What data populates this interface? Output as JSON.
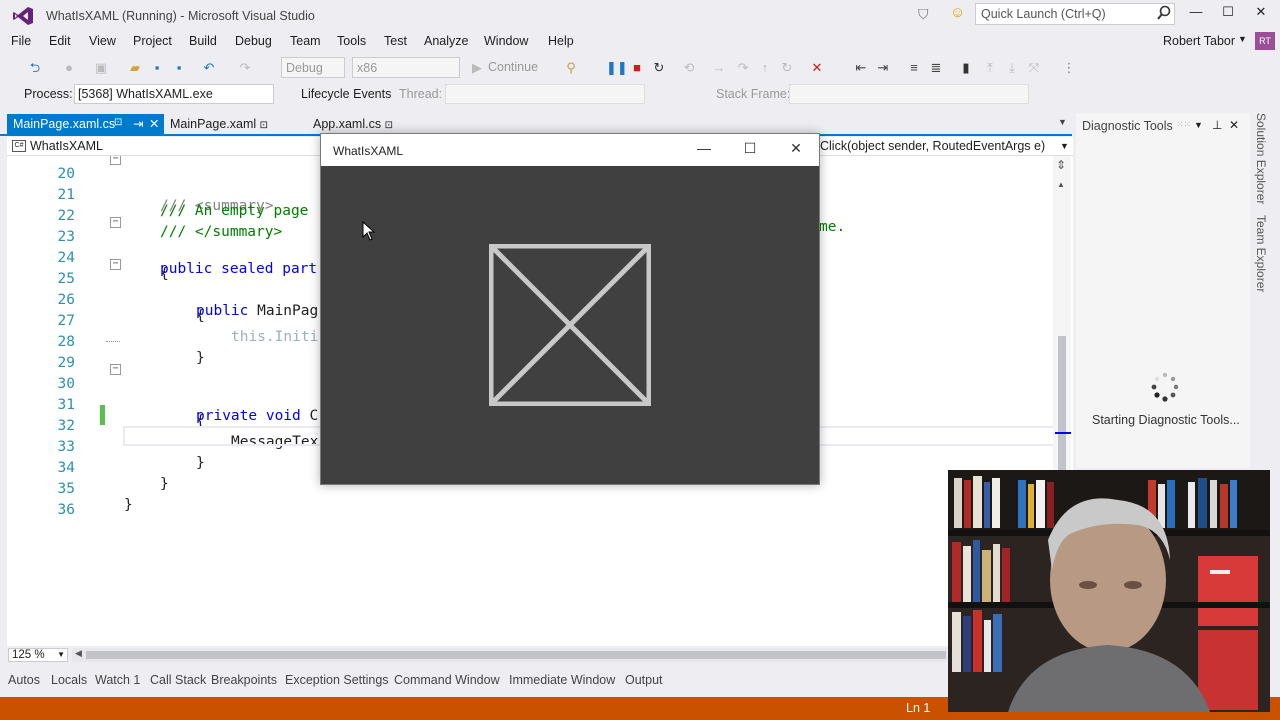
{
  "window": {
    "title": "WhatIsXAML (Running) - Microsoft Visual Studio",
    "quick_launch_placeholder": "Quick Launch (Ctrl+Q)",
    "minimize": "—",
    "maximize": "☐",
    "close": "✕"
  },
  "menu": [
    "File",
    "Edit",
    "View",
    "Project",
    "Build",
    "Debug",
    "Team",
    "Tools",
    "Test",
    "Analyze",
    "Window",
    "Help"
  ],
  "user": {
    "name": "Robert Tabor",
    "initials": "RT"
  },
  "toolbar": {
    "config": "Debug",
    "platform": "x86",
    "continue": "Continue"
  },
  "process_bar": {
    "process_label": "Process:",
    "process_value": "[5368] WhatIsXAML.exe",
    "lifecycle_label": "Lifecycle Events",
    "thread_label": "Thread:",
    "stack_frame_label": "Stack Frame:"
  },
  "tabs": [
    {
      "label": "MainPage.xaml.cs"
    },
    {
      "label": "MainPage.xaml"
    },
    {
      "label": "App.xaml.cs"
    }
  ],
  "navbar": {
    "project": "WhatIsXAML",
    "member": "Click(object sender, RoutedEventArgs e)"
  },
  "code": {
    "l20": {
      "num": "20",
      "text": "/// <summary>"
    },
    "l21": {
      "num": "21",
      "a": "/// An empty page ",
      "b": "me."
    },
    "l22": {
      "num": "22",
      "text": "/// </summary>"
    },
    "l23": {
      "num": "23",
      "kw": "public sealed part"
    },
    "l24": {
      "num": "24",
      "text": "{"
    },
    "l25": {
      "num": "25",
      "kw": "public",
      "rest": " MainPag"
    },
    "l26": {
      "num": "26",
      "text": "{"
    },
    "l27": {
      "num": "27",
      "kw": "this",
      "rest": ".Initi"
    },
    "l28": {
      "num": "28",
      "text": "}"
    },
    "l29": {
      "num": "29",
      "text": ""
    },
    "l30": {
      "num": "30",
      "kw": "private void",
      "rest": " C"
    },
    "l31": {
      "num": "31",
      "text": "{"
    },
    "l32": {
      "num": "32",
      "text": "MessageTex"
    },
    "l33": {
      "num": "33",
      "text": "}"
    },
    "l34": {
      "num": "34",
      "text": "}"
    },
    "l35": {
      "num": "35",
      "text": "}"
    },
    "l36": {
      "num": "36",
      "text": ""
    }
  },
  "zoom": "125 %",
  "app_window": {
    "title": "WhatIsXAML",
    "minimize": "—",
    "maximize": "☐",
    "close": "✕"
  },
  "diagnostics": {
    "title": "Diagnostic Tools",
    "status": "Starting Diagnostic Tools..."
  },
  "right_rail": [
    "Solution Explorer",
    "Team Explorer"
  ],
  "bottom_tabs": [
    "Autos",
    "Locals",
    "Watch 1",
    "Call Stack",
    "Breakpoints",
    "Exception Settings",
    "Command Window",
    "Immediate Window",
    "Output"
  ],
  "status_bar": {
    "line": "Ln 1"
  },
  "colors": {
    "accent": "#007acc",
    "status_bar": "#ca5100",
    "app_bg": "#404040"
  }
}
